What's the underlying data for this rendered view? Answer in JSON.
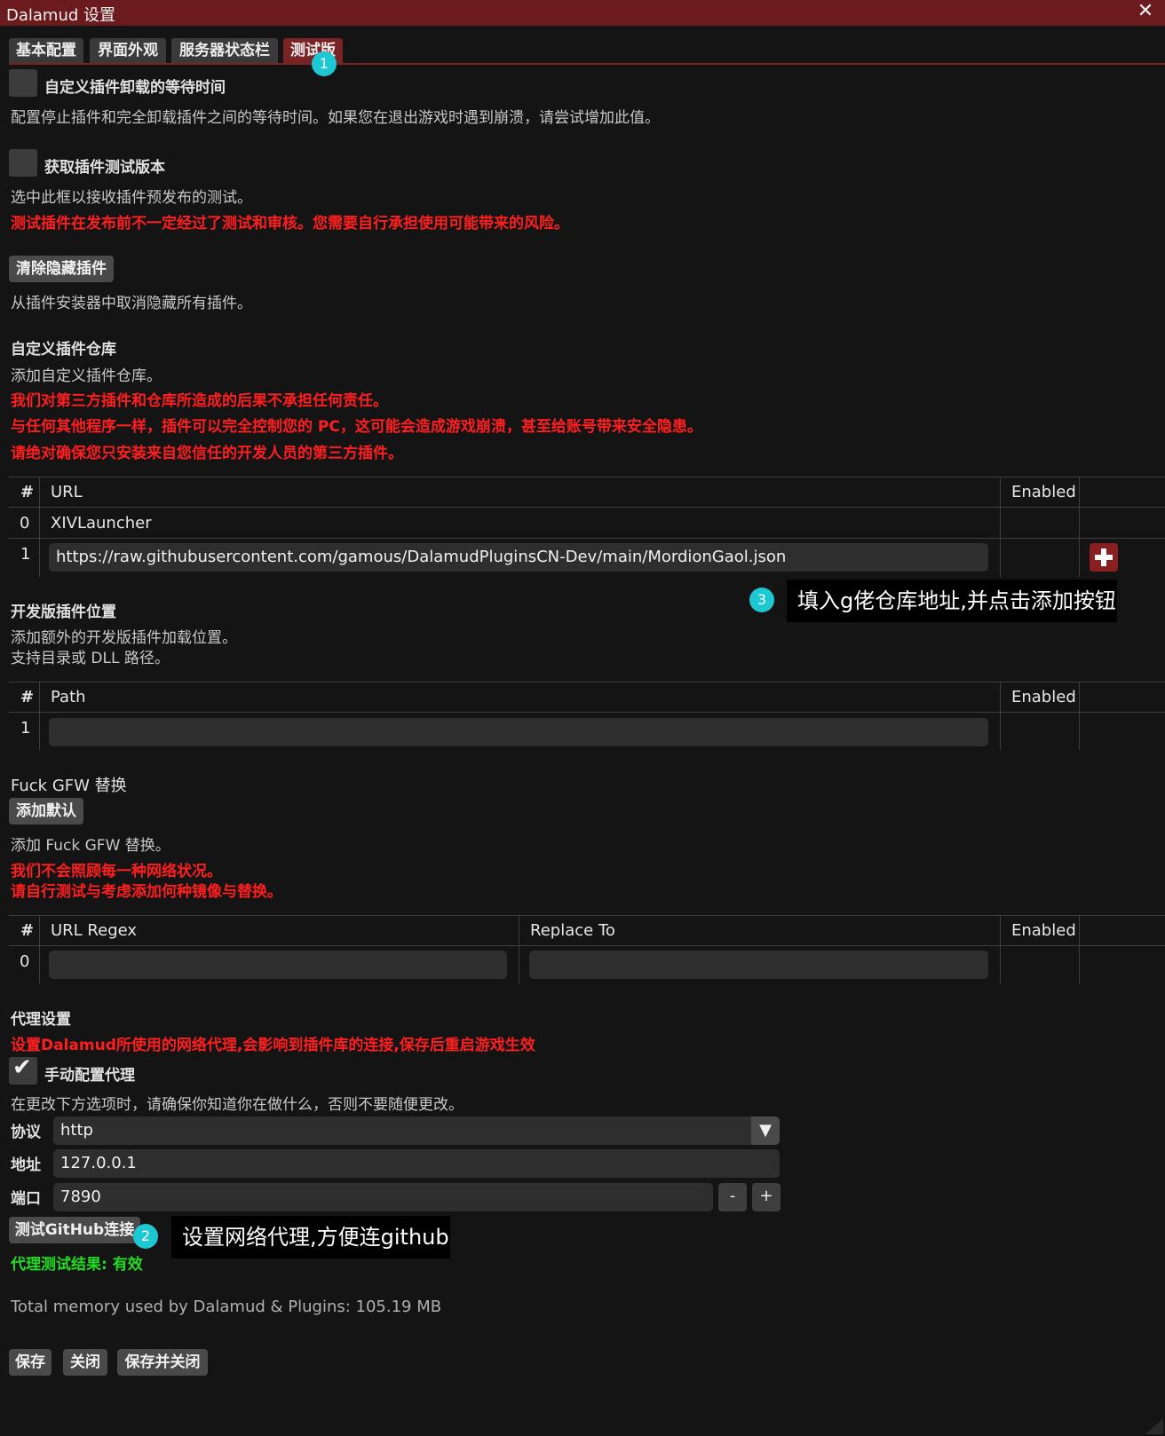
{
  "window": {
    "title": "Dalamud 设置",
    "close": "✕"
  },
  "tabs": [
    {
      "label": "基本配置"
    },
    {
      "label": "界面外观"
    },
    {
      "label": "服务器状态栏"
    },
    {
      "label": "测试版"
    }
  ],
  "badges": {
    "one": "1",
    "two": "2",
    "three": "3"
  },
  "callouts": {
    "repo": "填入g佬仓库地址,并点击添加按钮",
    "proxy": "设置网络代理,方便连github"
  },
  "unload_wait": {
    "label": "自定义插件卸载的等待时间",
    "desc": "配置停止插件和完全卸载插件之间的等待时间。如果您在退出游戏时遇到崩溃，请尝试增加此值。",
    "checked": false
  },
  "testing": {
    "label": "获取插件测试版本",
    "desc": "选中此框以接收插件预发布的测试。",
    "warning": "测试插件在发布前不一定经过了测试和审核。您需要自行承担使用可能带来的风险。",
    "checked": false
  },
  "hidden": {
    "button": "清除隐藏插件",
    "desc": "从插件安装器中取消隐藏所有插件。"
  },
  "repos": {
    "heading": "自定义插件仓库",
    "desc": "添加自定义插件仓库。",
    "warnings": [
      "我们对第三方插件和仓库所造成的后果不承担任何责任。",
      "与任何其他程序一样，插件可以完全控制您的 PC，这可能会造成游戏崩溃，甚至给账号带来安全隐患。",
      "请绝对确保您只安装来自您信任的开发人员的第三方插件。"
    ],
    "columns": {
      "num": "#",
      "url": "URL",
      "enabled": "Enabled"
    },
    "rows": [
      {
        "num": "0",
        "url": "XIVLauncher"
      }
    ],
    "new_row": {
      "num": "1",
      "value": "https://raw.githubusercontent.com/gamous/DalamudPluginsCN-Dev/main/MordionGaol.json"
    },
    "add_icon": "plus-icon"
  },
  "dev": {
    "heading": "开发版插件位置",
    "desc1": "添加额外的开发版插件加载位置。",
    "desc2": "支持目录或 DLL 路径。",
    "columns": {
      "num": "#",
      "path": "Path",
      "enabled": "Enabled"
    },
    "new_row": {
      "num": "1",
      "value": ""
    }
  },
  "gfw": {
    "heading": "Fuck GFW 替换",
    "button": "添加默认",
    "desc": "添加 Fuck GFW 替换。",
    "warnings": [
      "我们不会照顾每一种网络状况。",
      "请自行测试与考虑添加何种镜像与替换。"
    ],
    "columns": {
      "num": "#",
      "regex": "URL Regex",
      "replace": "Replace To",
      "enabled": "Enabled"
    },
    "new_row": {
      "num": "0",
      "regex": "",
      "replace": ""
    }
  },
  "proxy": {
    "heading": "代理设置",
    "warning": "设置Dalamud所使用的网络代理,会影响到插件库的连接,保存后重启游戏生效",
    "manual_label": "手动配置代理",
    "manual_checked": true,
    "check_glyph": "✔",
    "caution": "在更改下方选项时，请确保你知道你在做什么，否则不要随便更改。",
    "protocol_label": "协议",
    "protocol_value": "http",
    "dropdown_glyph": "▼",
    "address_label": "地址",
    "address_value": "127.0.0.1",
    "port_label": "端口",
    "port_value": "7890",
    "minus": "-",
    "plus": "+",
    "test_button": "测试GitHub连接",
    "result": "代理测试结果: 有效"
  },
  "memory": "Total memory used by Dalamud & Plugins: 105.19 MB",
  "footer": {
    "save": "保存",
    "close": "关闭",
    "save_close": "保存并关闭"
  },
  "colors": {
    "accent": "#7a2325",
    "titlebar": "#6b1a1d",
    "warning": "#ff1e1e",
    "success": "#22dd22",
    "badge": "#1ec8d2"
  }
}
